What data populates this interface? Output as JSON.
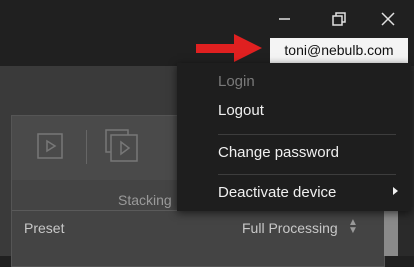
{
  "window": {
    "controls": {
      "minimize": "minimize-icon",
      "restore": "restore-icon",
      "close": "close-icon"
    }
  },
  "account": {
    "email": "toni@nebulb.com"
  },
  "annotation": {
    "arrow_color": "#e02020"
  },
  "menu": {
    "items": [
      {
        "label": "Login",
        "enabled": false
      },
      {
        "label": "Logout",
        "enabled": true
      },
      {
        "label": "Change password",
        "enabled": true
      },
      {
        "label": "Deactivate device",
        "enabled": true,
        "has_submenu": true
      }
    ]
  },
  "panel": {
    "section_title": "Stacking",
    "preset_label": "Preset",
    "preset_value": "Full Processing"
  }
}
